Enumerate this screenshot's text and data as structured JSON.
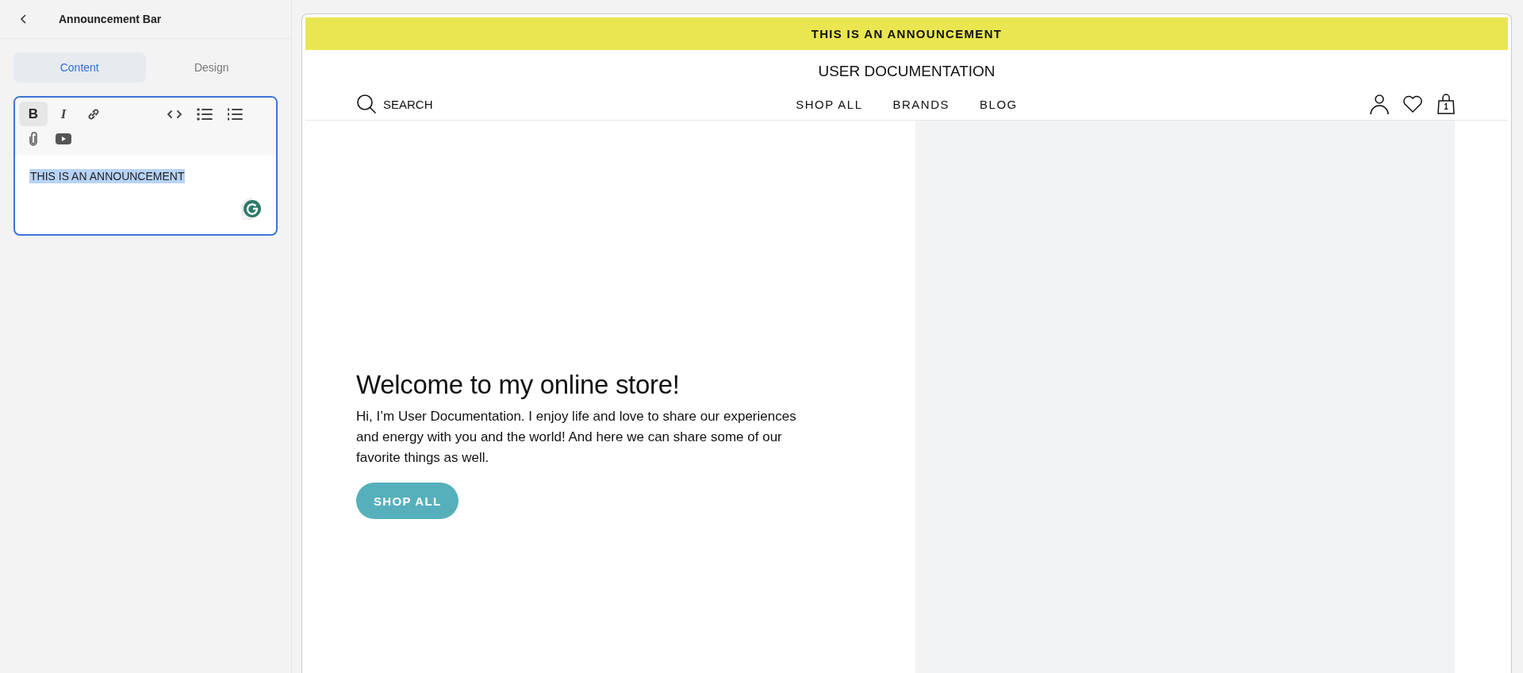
{
  "panel": {
    "title": "Announcement Bar",
    "tabs": [
      {
        "label": "Content",
        "selected": true
      },
      {
        "label": "Design",
        "selected": false
      }
    ],
    "toolbar_rows": [
      {
        "items": [
          {
            "kind": "bold",
            "glyph": "B",
            "active": true
          },
          {
            "kind": "italic",
            "glyph": "I",
            "active": false
          },
          {
            "kind": "link",
            "active": false
          },
          {
            "kind": "code",
            "active": false
          },
          {
            "kind": "bullets",
            "active": false
          },
          {
            "kind": "numbers",
            "active": false
          }
        ]
      },
      {
        "items": [
          {
            "kind": "attach",
            "active": false
          },
          {
            "kind": "video",
            "active": false
          }
        ]
      }
    ],
    "editor_text": "THIS IS AN ANNOUNCEMENT",
    "editor_text_selected": true
  },
  "preview": {
    "announcement": "THIS IS AN ANNOUNCEMENT",
    "store_name": "USER DOCUMENTATION",
    "search_label": "SEARCH",
    "nav_links": [
      "SHOP ALL",
      "BRANDS",
      "BLOG"
    ],
    "cart_count": "1",
    "hero": {
      "heading": "Welcome to my online store!",
      "text": "Hi, I’m User Documentation. I enjoy life and love to share our experiences and energy with you and the world! And here we can share some of our favorite things as well.",
      "button": "SHOP ALL"
    }
  }
}
